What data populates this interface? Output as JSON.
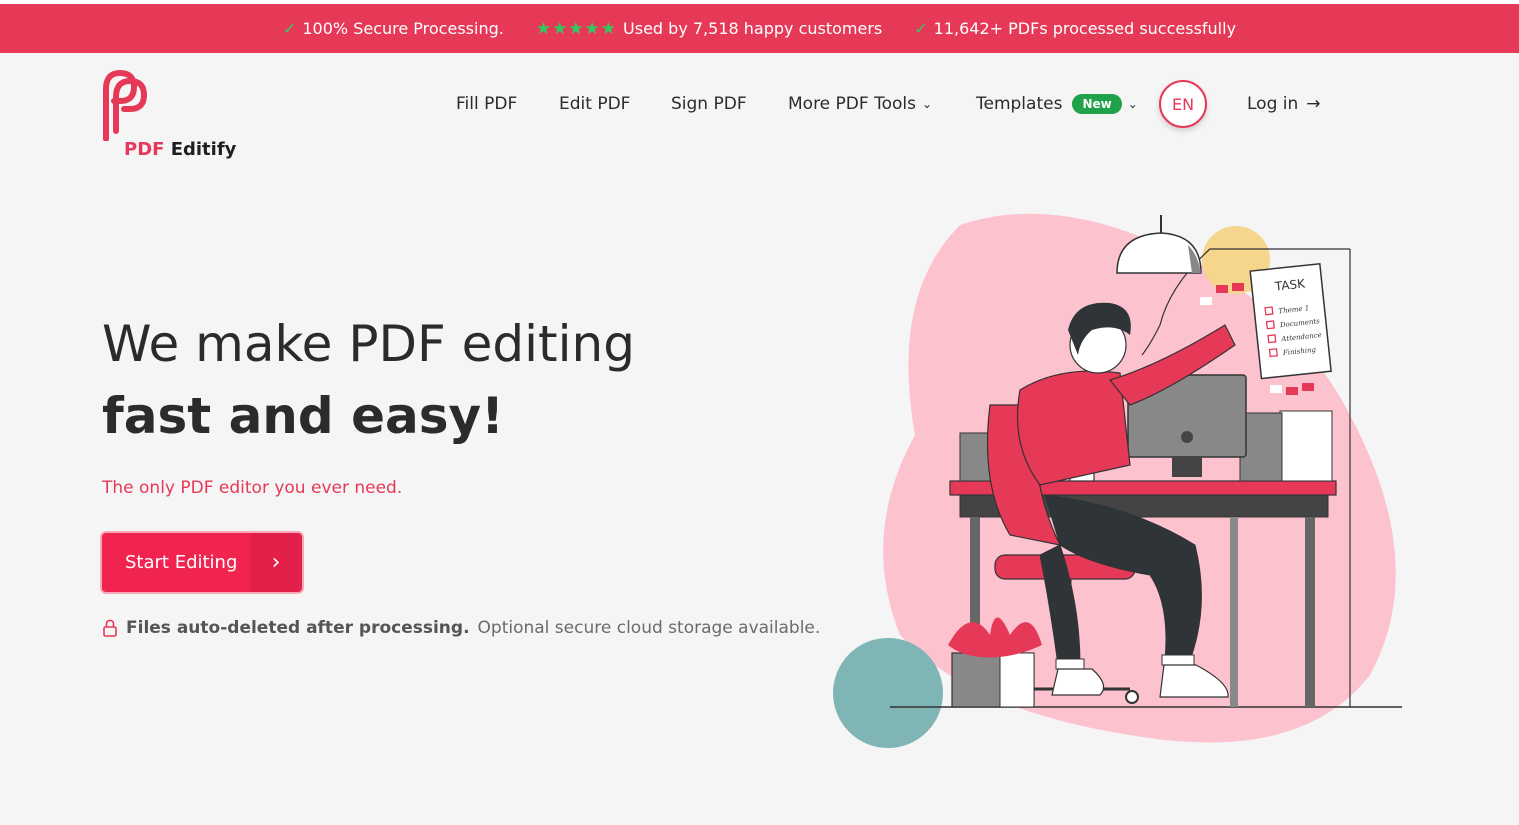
{
  "promo_bar": {
    "item1": "100% Secure Processing.",
    "stars": "★★★★★",
    "item2": "Used by 7,518 happy customers",
    "item3": "11,642+ PDFs processed successfully"
  },
  "brand": {
    "logo_pdf": "PDF",
    "logo_name": " Editify",
    "accent": "#e63958"
  },
  "nav": {
    "fill_pdf": "Fill PDF",
    "edit_pdf": "Edit PDF",
    "sign_pdf": "Sign PDF",
    "more_tools": "More PDF Tools",
    "templates": "Templates",
    "templates_badge": "New",
    "language": "EN",
    "login": "Log in"
  },
  "hero": {
    "title_line1": "We make PDF editing",
    "title_line2": "fast and easy!",
    "tagline": "The only PDF editor you ever need.",
    "cta_label": "Start Editing",
    "notice_strong": "Files auto-deleted after processing.",
    "notice_rest": "Optional secure cloud storage available."
  },
  "illustration": {
    "task_title": "TASK",
    "task_items": [
      "Theme 1",
      "Documents",
      "Attendance",
      "Finishing"
    ]
  }
}
